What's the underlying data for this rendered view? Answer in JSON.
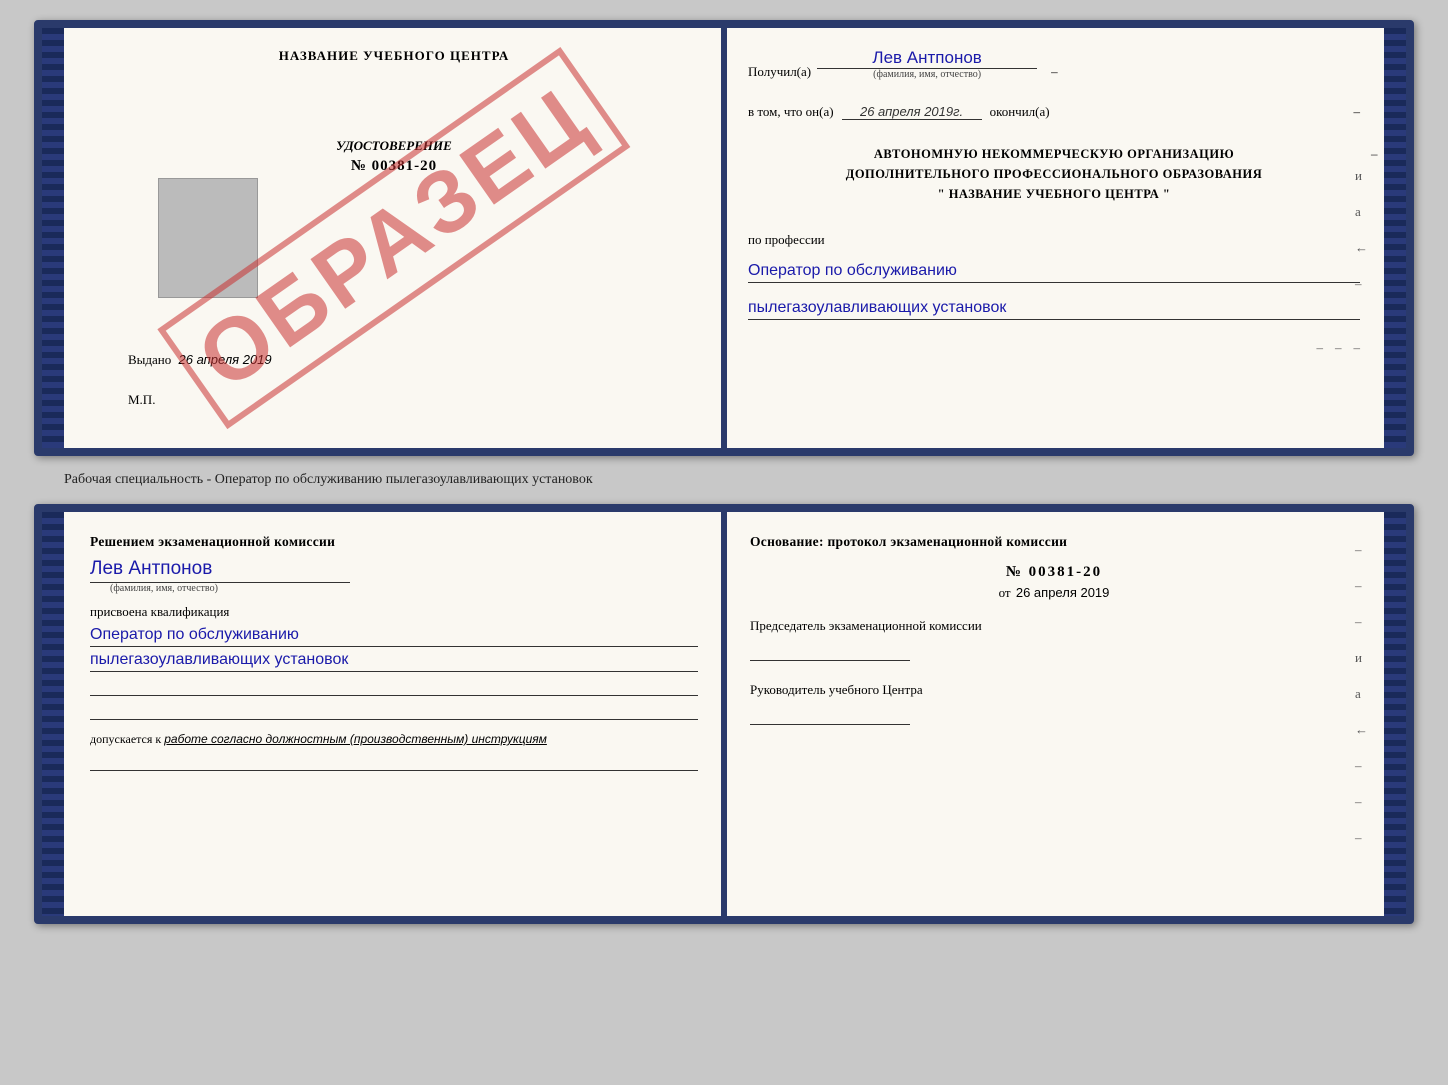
{
  "top_card": {
    "left": {
      "title": "НАЗВАНИЕ УЧЕБНОГО ЦЕНТРА",
      "watermark": "ОБРАЗЕЦ",
      "udostoverenie_label": "УДОСТОВЕРЕНИЕ",
      "udostoverenie_num": "№ 00381-20",
      "vydano_label": "Выдано",
      "vydano_date": "26 апреля 2019",
      "mp_label": "М.П."
    },
    "right": {
      "poluchil_label": "Получил(а)",
      "recipient_name": "Лев Антпонов",
      "fio_sub": "(фамилия, имя, отчество)",
      "dash1": "–",
      "vtom_label": "в том, что он(а)",
      "date_value": "26 апреля 2019г.",
      "okonchil_label": "окончил(а)",
      "dash2": "–",
      "org_line1": "АВТОНОМНУЮ НЕКОММЕРЧЕСКУЮ ОРГАНИЗАЦИЮ",
      "org_line2": "ДОПОЛНИТЕЛЬНОГО ПРОФЕССИОНАЛЬНОГО ОБРАЗОВАНИЯ",
      "org_line3": "\"  НАЗВАНИЕ УЧЕБНОГО ЦЕНТРА  \"",
      "dash3": "–",
      "i_label": "и",
      "a_label": "а",
      "arrow_label": "←",
      "dash4": "–",
      "po_professii_label": "по профессии",
      "profession_line1": "Оператор по обслуживанию",
      "profession_line2": "пылегазоулавливающих установок",
      "dash5": "–",
      "dash6": "–",
      "dash7": "–"
    }
  },
  "between_label": "Рабочая специальность - Оператор по обслуживанию пылегазоулавливающих установок",
  "bottom_card": {
    "left": {
      "resheniyem_label": "Решением экзаменационной комиссии",
      "name": "Лев Антпонов",
      "fio_sub": "(фамилия, имя, отчество)",
      "prisvoena_label": "присвоена квалификация",
      "kval_line1": "Оператор по обслуживанию",
      "kval_line2": "пылегазоулавливающих установок",
      "dopuskaetsya_label": "допускается к",
      "dopuskaetsya_value": "работе согласно должностным (производственным) инструкциям"
    },
    "right": {
      "osnovanie_label": "Основание: протокол экзаменационной комиссии",
      "protokol_num": "№  00381-20",
      "ot_label": "от",
      "ot_date": "26 апреля 2019",
      "predsedatel_label": "Председатель экзаменационной комиссии",
      "rukovoditel_label": "Руководитель учебного Центра",
      "dash1": "–",
      "dash2": "–",
      "dash3": "–",
      "i_label": "и",
      "a_label": "а",
      "arrow_label": "←",
      "dash4": "–",
      "dash5": "–",
      "dash6": "–"
    }
  }
}
